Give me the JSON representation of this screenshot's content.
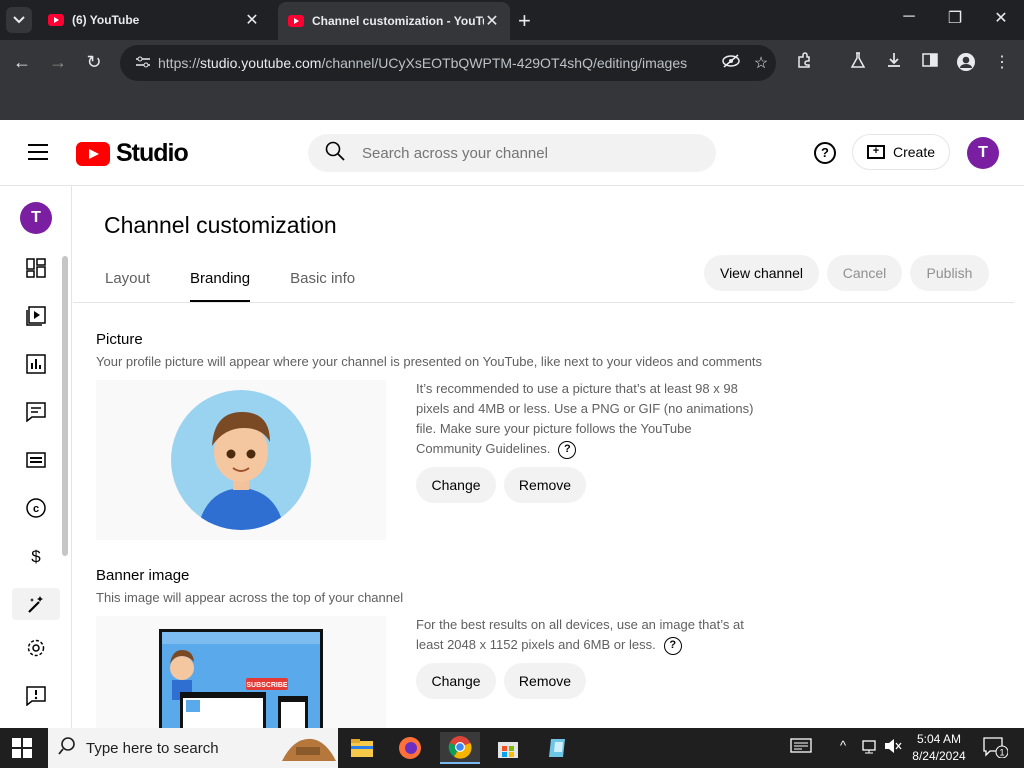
{
  "browser": {
    "tabs": [
      {
        "title": "(6) YouTube"
      },
      {
        "title": "Channel customization - YouTube Studio"
      }
    ],
    "url_prefix": "https://",
    "url_host": "studio.youtube.com",
    "url_path": "/channel/UCyXsEOTbQWPTM-429OT4shQ/editing/images"
  },
  "header": {
    "logo_text": "Studio",
    "search_placeholder": "Search across your channel",
    "create_label": "Create",
    "avatar_letter": "T"
  },
  "sidebar": {
    "avatar_letter": "T",
    "items": [
      {
        "icon": "dashboard-icon"
      },
      {
        "icon": "content-icon"
      },
      {
        "icon": "analytics-icon"
      },
      {
        "icon": "comments-icon"
      },
      {
        "icon": "subtitles-icon"
      },
      {
        "icon": "copyright-icon"
      },
      {
        "icon": "earn-icon"
      },
      {
        "icon": "customization-icon"
      },
      {
        "icon": "settings-icon"
      },
      {
        "icon": "feedback-icon"
      }
    ]
  },
  "page": {
    "title": "Channel customization",
    "tabs": [
      {
        "label": "Layout",
        "active": false
      },
      {
        "label": "Branding",
        "active": true
      },
      {
        "label": "Basic info",
        "active": false
      }
    ],
    "view_channel": "View channel",
    "cancel": "Cancel",
    "publish": "Publish"
  },
  "picture": {
    "title": "Picture",
    "subtitle": "Your profile picture will appear where your channel is presented on YouTube, like next to your videos and comments",
    "description": "It’s recommended to use a picture that’s at least 98 x 98 pixels and 4MB or less. Use a PNG or GIF (no animations) file. Make sure your picture follows the YouTube Community Guidelines.",
    "change": "Change",
    "remove": "Remove"
  },
  "banner": {
    "title": "Banner image",
    "subtitle": "This image will appear across the top of your channel",
    "description": "For the best results on all devices, use an image that’s at least 2048 x 1152 pixels and 6MB or less.",
    "change": "Change",
    "remove": "Remove",
    "preview_button_text": "SUBSCRIBE"
  },
  "taskbar": {
    "search_placeholder": "Type here to search",
    "time": "5:04 AM",
    "date": "8/24/2024",
    "notification_count": "1"
  },
  "colors": {
    "accent": "#ff0000",
    "avatar": "#7b1fa2"
  }
}
